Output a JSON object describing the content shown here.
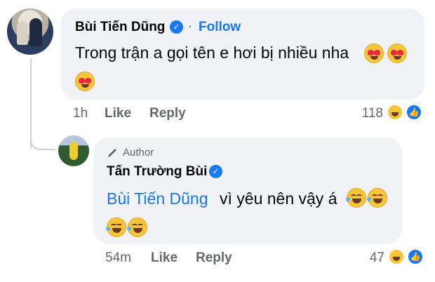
{
  "comment": {
    "author_name": "Bùi Tiến Dũng",
    "follow_label": "Follow",
    "text": "Trong trận a gọi tên e hơi bị nhiều nha",
    "time": "1h",
    "like_label": "Like",
    "reply_label": "Reply",
    "reaction_count": "118"
  },
  "reply": {
    "badge_label": "Author",
    "author_name": "Tấn Trường Bùi",
    "mention": "Bùi Tiến Dũng",
    "text": "vì yêu nên vậy á",
    "time": "54m",
    "like_label": "Like",
    "reply_label": "Reply",
    "reaction_count": "47"
  },
  "colors": {
    "bubble_bg": "#f0f2f5",
    "link_blue": "#1877f2",
    "meta_gray": "#65676b"
  }
}
